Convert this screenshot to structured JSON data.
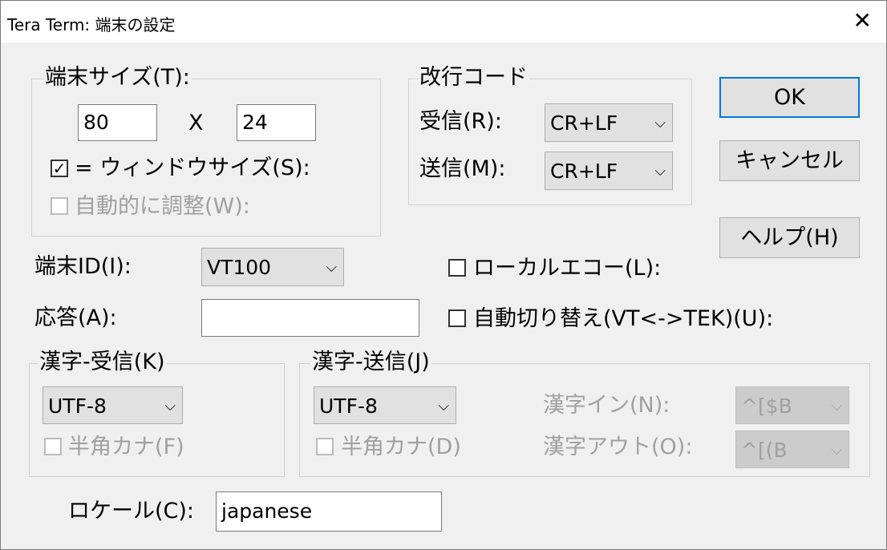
{
  "window": {
    "title": "Tera Term: 端末の設定",
    "close_glyph": "✕"
  },
  "terminal_size": {
    "legend": "端末サイズ(T):",
    "cols": "80",
    "x_sep": "X",
    "rows": "24",
    "window_size_label": "= ウィンドウサイズ(S):",
    "window_size_checked": true,
    "auto_resize_label": "自動的に調整(W):",
    "auto_resize_checked": false
  },
  "newline": {
    "legend": "改行コード",
    "receive_label": "受信(R):",
    "receive_value": "CR+LF",
    "transmit_label": "送信(M):",
    "transmit_value": "CR+LF"
  },
  "buttons": {
    "ok": "OK",
    "cancel": "キャンセル",
    "help": "ヘルプ(H)"
  },
  "terminal_id": {
    "label": "端末ID(I):",
    "value": "VT100"
  },
  "answerback": {
    "label": "応答(A):",
    "value": ""
  },
  "local_echo": {
    "label": "ローカルエコー(L):",
    "checked": false
  },
  "auto_switch": {
    "label": "自動切り替え(VT<->TEK)(U):",
    "checked": false
  },
  "kanji_receive": {
    "legend": "漢字-受信(K)",
    "value": "UTF-8",
    "halfwidth_label": "半角カナ(F)",
    "halfwidth_checked": false
  },
  "kanji_transmit": {
    "legend": "漢字-送信(J)",
    "value": "UTF-8",
    "halfwidth_label": "半角カナ(D)",
    "halfwidth_checked": false,
    "kanji_in_label": "漢字イン(N):",
    "kanji_in_value": "^[$B",
    "kanji_out_label": "漢字アウト(O):",
    "kanji_out_value": "^[(B"
  },
  "locale": {
    "label": "ロケール(C):",
    "value": "japanese"
  },
  "icons": {
    "check": "✓",
    "chevron": "⌵"
  }
}
